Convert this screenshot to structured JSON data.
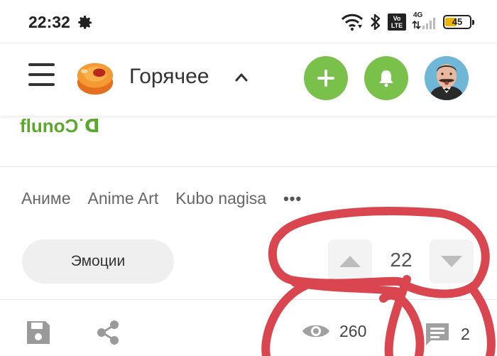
{
  "status_bar": {
    "time": "22:32",
    "network_badge": "4G",
    "volte_line1": "Vo",
    "volte_line2": "LTE",
    "battery_level": "45",
    "battery_color": "#f0b400"
  },
  "header": {
    "feed_title": "Горячее",
    "accent_color": "#79c14a",
    "icons": [
      "menu-icon",
      "pikabu-logo",
      "chevron-up-icon",
      "plus-icon",
      "bell-icon",
      "avatar"
    ]
  },
  "post": {
    "author_snippet": "flunoϽ˙ꓷ",
    "tags": [
      "Аниме",
      "Anime Art",
      "Kubo nagisa"
    ],
    "more_label": "•••",
    "emotions_label": "Эмоции",
    "rating": "22",
    "views": "260",
    "comments": "2"
  },
  "annotation_color": "#d9464f"
}
